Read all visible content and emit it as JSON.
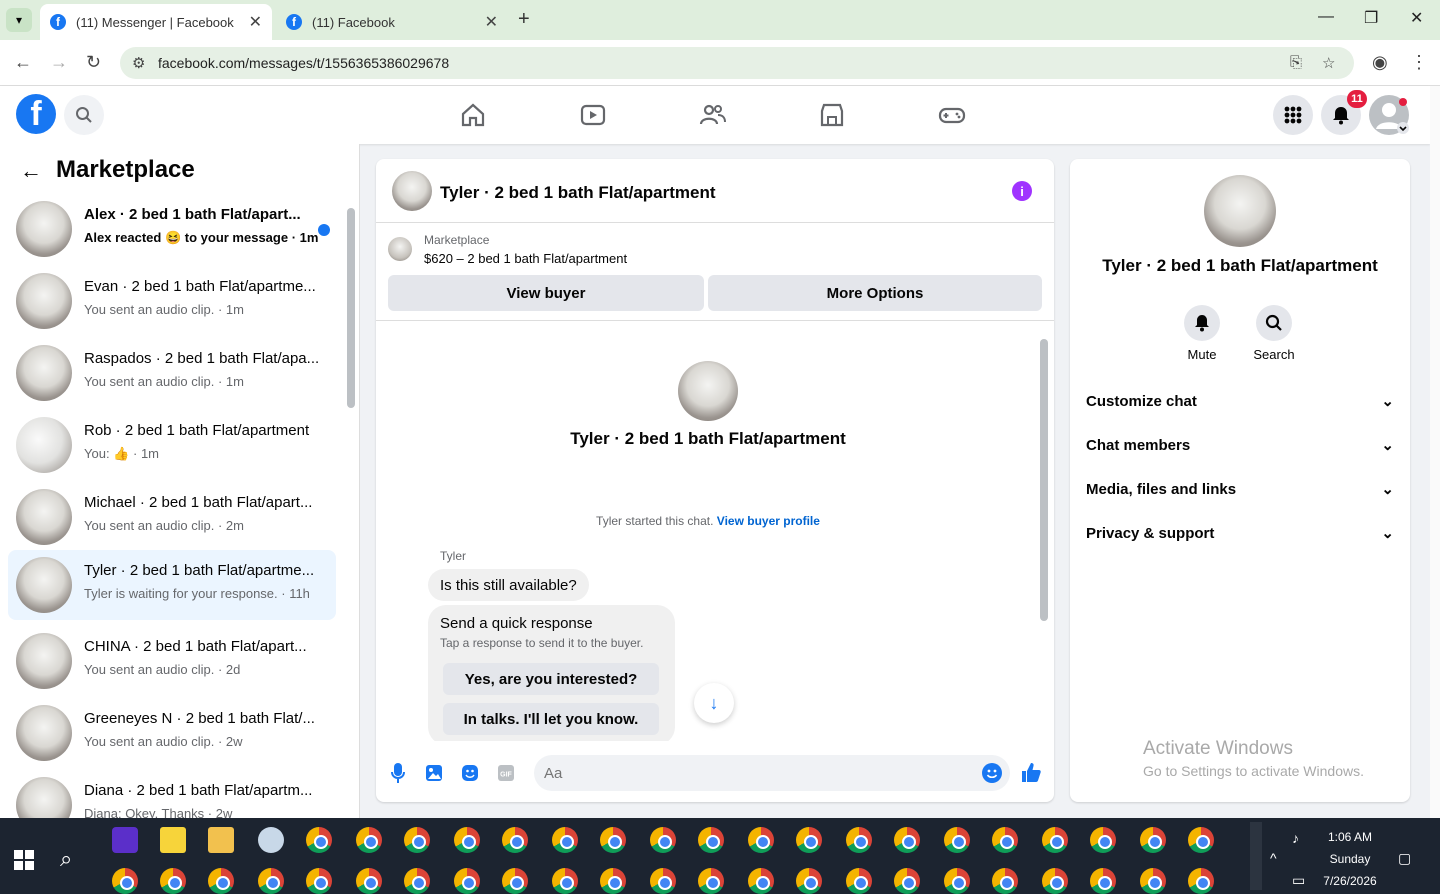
{
  "browser": {
    "tabs": [
      {
        "title": "(11) Messenger | Facebook",
        "active": true
      },
      {
        "title": "(11) Facebook",
        "active": false
      }
    ],
    "url": "facebook.com/messages/t/1556365386029678"
  },
  "header": {
    "notification_count": "11",
    "nav_icons": [
      "home-icon",
      "watch-icon",
      "friends-icon",
      "marketplace-icon",
      "gaming-icon"
    ]
  },
  "sidebar": {
    "title": "Marketplace",
    "conversations": [
      {
        "title": "Alex · 2 bed 1 bath Flat/apart...",
        "subtitle_pre": "Alex reacted",
        "subtitle_emoji": "😆",
        "subtitle_post": "to your message · 1m",
        "unread": true
      },
      {
        "title": "Evan · 2 bed 1 bath Flat/apartme...",
        "subtitle": "You sent an audio clip. · 1m"
      },
      {
        "title": "Raspados · 2 bed 1 bath Flat/apa...",
        "subtitle": "You sent an audio clip. · 1m"
      },
      {
        "title": "Rob · 2 bed 1 bath Flat/apartment",
        "subtitle_pre": "You:",
        "subtitle_post": "· 1m"
      },
      {
        "title": "Michael · 2 bed 1 bath Flat/apart...",
        "subtitle": "You sent an audio clip. · 2m"
      },
      {
        "title": "Tyler · 2 bed 1 bath Flat/apartme...",
        "subtitle": "Tyler is waiting for your response. · 11h",
        "selected": true
      },
      {
        "title": "CHINA · 2 bed 1 bath Flat/apart...",
        "subtitle": "You sent an audio clip. · 2d"
      },
      {
        "title": "Greeneyes N · 2 bed 1 bath Flat/...",
        "subtitle": "You sent an audio clip. · 2w"
      },
      {
        "title": "Diana · 2 bed 1 bath Flat/apartm...",
        "subtitle": "Diana: Okey. Thanks · 2w"
      }
    ]
  },
  "chat": {
    "title": "Tyler · 2 bed 1 bath Flat/apartment",
    "marketplace_label": "Marketplace",
    "listing": "$620 – 2 bed 1 bath Flat/apartment",
    "view_buyer_label": "View buyer",
    "more_options_label": "More Options",
    "center_title": "Tyler · 2 bed 1 bath Flat/apartment",
    "started_text": "Tyler started this chat.",
    "view_profile_link": "View buyer profile",
    "sender": "Tyler",
    "message": "Is this still available?",
    "quick_title": "Send a quick response",
    "quick_sub": "Tap a response to send it to the buyer.",
    "quick_options": [
      "Yes, are you interested?",
      "In talks. I'll let you know."
    ],
    "composer_placeholder": "Aa"
  },
  "details": {
    "title": "Tyler · 2 bed 1 bath Flat/apartment",
    "actions": [
      {
        "label": "Mute",
        "icon": "bell-icon"
      },
      {
        "label": "Search",
        "icon": "search-icon"
      }
    ],
    "sections": [
      "Customize chat",
      "Chat members",
      "Media, files and links",
      "Privacy & support"
    ]
  },
  "watermark": {
    "title": "Activate Windows",
    "subtitle": "Go to Settings to activate Windows."
  },
  "taskbar": {
    "time": "1:06 AM",
    "day": "Sunday",
    "date": "7/26/2026"
  },
  "colors": {
    "brand": "#1877f2",
    "tab_bar": "#dfeedd",
    "badge": "#e41e3f",
    "info": "#a033ff"
  }
}
